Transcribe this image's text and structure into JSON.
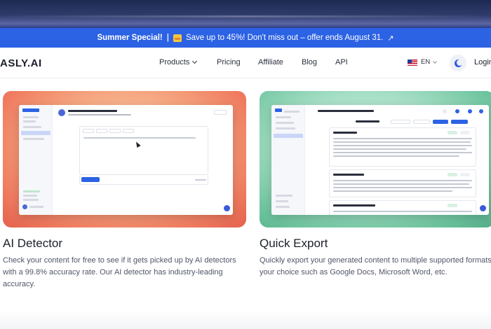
{
  "promo": {
    "headline": "Summer Special!",
    "separator": "|",
    "emoji_icon": "tada-icon",
    "message": "Save up to 45%! Don't miss out – offer ends August 31.",
    "external_icon": "external-link-icon"
  },
  "nav": {
    "logo": "ASLY.AI",
    "items": [
      {
        "label": "Products",
        "has_dropdown": true
      },
      {
        "label": "Pricing"
      },
      {
        "label": "Affiliate"
      },
      {
        "label": "Blog"
      },
      {
        "label": "API"
      }
    ],
    "language": "EN",
    "language_flag": "us-flag-icon",
    "theme_icon": "moon-icon",
    "login": "Login"
  },
  "features": [
    {
      "title": "AI Detector",
      "description": "Check your content for free to see if it gets picked up by AI detectors with a 99.8% accuracy rate. Our AI detector has industry-leading accuracy."
    },
    {
      "title": "Quick Export",
      "description": "Quickly export your generated content to multiple supported formats of your choice such as Google Docs, Microsoft Word, etc."
    }
  ],
  "colors": {
    "brand_blue": "#2c62e4",
    "detector_card": "#f6a882",
    "export_card": "#6cc39e"
  }
}
